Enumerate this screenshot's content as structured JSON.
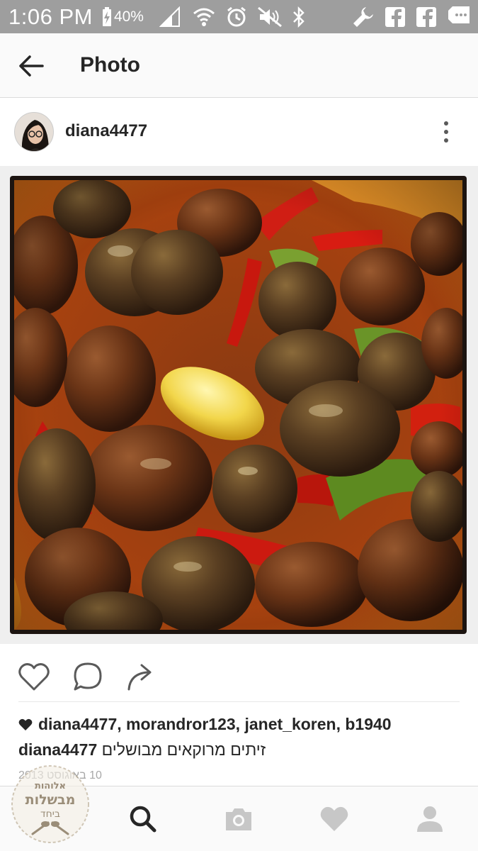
{
  "status": {
    "time": "1:06 PM",
    "battery": "40%"
  },
  "appbar": {
    "title": "Photo"
  },
  "post": {
    "username": "diana4477",
    "likes_text": "diana4477, morandror123, janet_koren, b1940",
    "caption_user": "diana4477",
    "caption_text": "זיתים מרוקאים מבושלים",
    "date_text": "10 באוגוסט 2013"
  },
  "watermark": {
    "line1": "מבשלות",
    "line2": "ביחד",
    "top": "אלוהות"
  },
  "colors": {
    "status_bar": "#9e9e9e",
    "app_bar": "#fafafa",
    "text": "#262626",
    "muted": "#a8a8a8",
    "icon_inactive": "#c7c7c7"
  },
  "icons": {
    "back": "arrow-left-icon",
    "more": "more-vertical-icon",
    "like": "heart-outline-icon",
    "comment": "comment-icon",
    "share": "share-arrow-icon",
    "nav_search": "search-icon",
    "nav_camera": "camera-icon",
    "nav_activity": "heart-icon",
    "nav_profile": "person-icon"
  }
}
